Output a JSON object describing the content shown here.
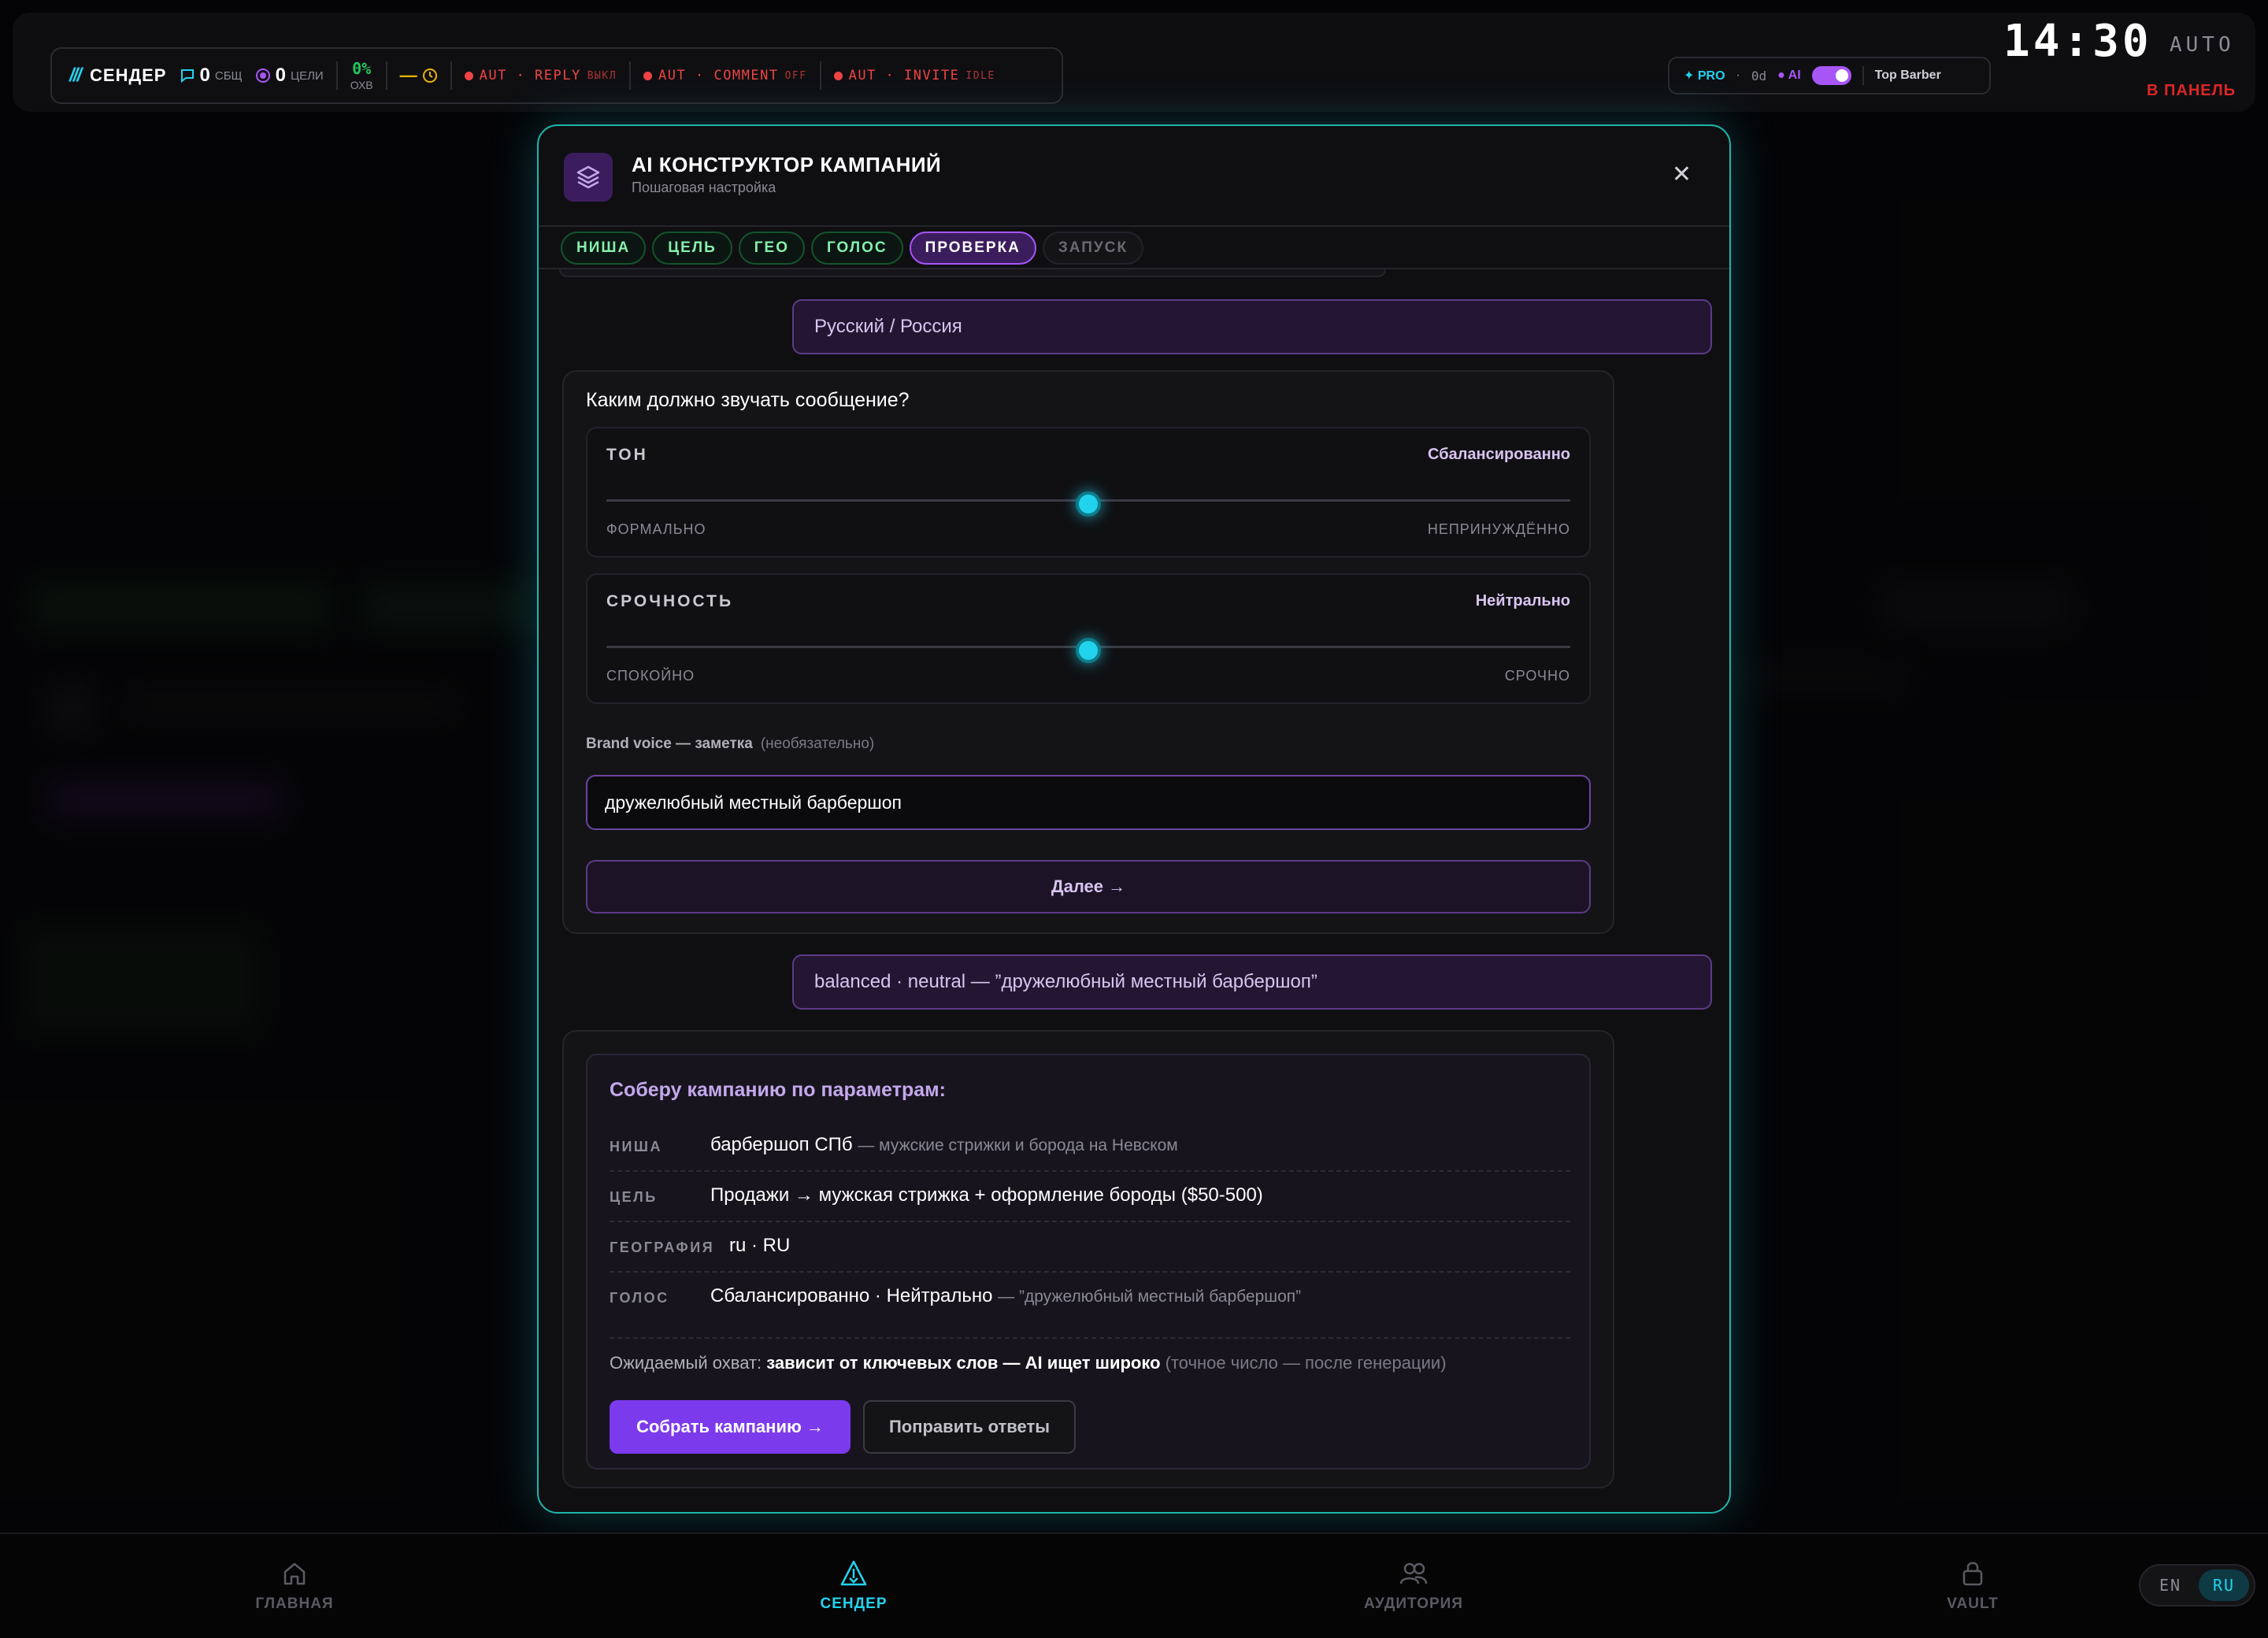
{
  "topbar": {
    "brand": "СЕНДЕР",
    "msg_count": "0",
    "msg_label": "СБЩ",
    "goal_count": "0",
    "goal_label": "ЦЕЛИ",
    "reach_value": "0%",
    "reach_label": "ОХВ",
    "auto_items": [
      {
        "label": "AUT · REPLY",
        "state": "ВЫКЛ"
      },
      {
        "label": "AUT · COMMENT",
        "state": "OFF"
      },
      {
        "label": "AUT · INVITE",
        "state": "IDLE"
      }
    ],
    "pro_label": "✦ PRO",
    "days": "0d",
    "ai_label": "● AI",
    "account": "Top Barber",
    "clock": "14:30",
    "auto": "AUTO",
    "panel_link": "В ПАНЕЛЬ"
  },
  "modal": {
    "title": "AI КОНСТРУКТОР КАМПАНИЙ",
    "subtitle": "Пошаговая настройка",
    "close": "✕",
    "steps": [
      {
        "label": "НИША",
        "state": "done"
      },
      {
        "label": "ЦЕЛЬ",
        "state": "done"
      },
      {
        "label": "ГЕО",
        "state": "done"
      },
      {
        "label": "ГОЛОС",
        "state": "done"
      },
      {
        "label": "ПРОВЕРКА",
        "state": "active"
      },
      {
        "label": "ЗАПУСК",
        "state": "pending"
      }
    ],
    "geo_answer": "Русский / Россия",
    "voice_question": "Каким должно звучать сообщение?",
    "tone": {
      "name": "ТОН",
      "value_label": "Сбалансированно",
      "low": "ФОРМАЛЬНО",
      "high": "НЕПРИНУЖДЁННО",
      "level": 0.5
    },
    "urgency": {
      "name": "СРОЧНОСТЬ",
      "value_label": "Нейтрально",
      "low": "СПОКОЙНО",
      "high": "СРОЧНО",
      "level": 0.5
    },
    "brand_voice_label": "Brand voice — заметка",
    "brand_voice_optional": "(необязательно)",
    "brand_voice_value": "дружелюбный местный барбершоп",
    "next_button": "Далее →",
    "voice_answer": "balanced · neutral — ”дружелюбный местный барбершоп”",
    "summary": {
      "title": "Соберу кампанию по параметрам:",
      "rows": [
        {
          "key": "НИША",
          "value": "барбершоп СПб",
          "extra": "— мужские стрижки и борода на Невском"
        },
        {
          "key": "ЦЕЛЬ",
          "value": "Продажи → мужская стрижка + оформление бороды ($50-500)",
          "extra": ""
        },
        {
          "key": "ГЕОГРАФИЯ",
          "value": "ru · RU",
          "extra": ""
        },
        {
          "key": "ГОЛОС",
          "value": "Сбалансированно · Нейтрально",
          "extra": "— ”дружелюбный местный барбершоп”"
        }
      ],
      "reach_prefix": "Ожидаемый охват:",
      "reach_bold": "зависит от ключевых слов — AI ищет широко",
      "reach_suffix": "(точное число — после генерации)",
      "build_button": "Собрать кампанию →",
      "edit_button": "Поправить ответы"
    }
  },
  "bottom_nav": [
    {
      "label": "ГЛАВНАЯ",
      "icon": "home-icon",
      "active": false
    },
    {
      "label": "СЕНДЕР",
      "icon": "sender-icon",
      "active": true
    },
    {
      "label": "АУДИТОРИЯ",
      "icon": "audience-icon",
      "active": false
    },
    {
      "label": "VAULT",
      "icon": "lock-icon",
      "active": false
    }
  ],
  "lang": {
    "en": "EN",
    "ru": "RU",
    "active": "RU"
  },
  "colors": {
    "accent_cyan": "#22d3ee",
    "accent_purple": "#a855f7",
    "danger": "#ef4444"
  }
}
